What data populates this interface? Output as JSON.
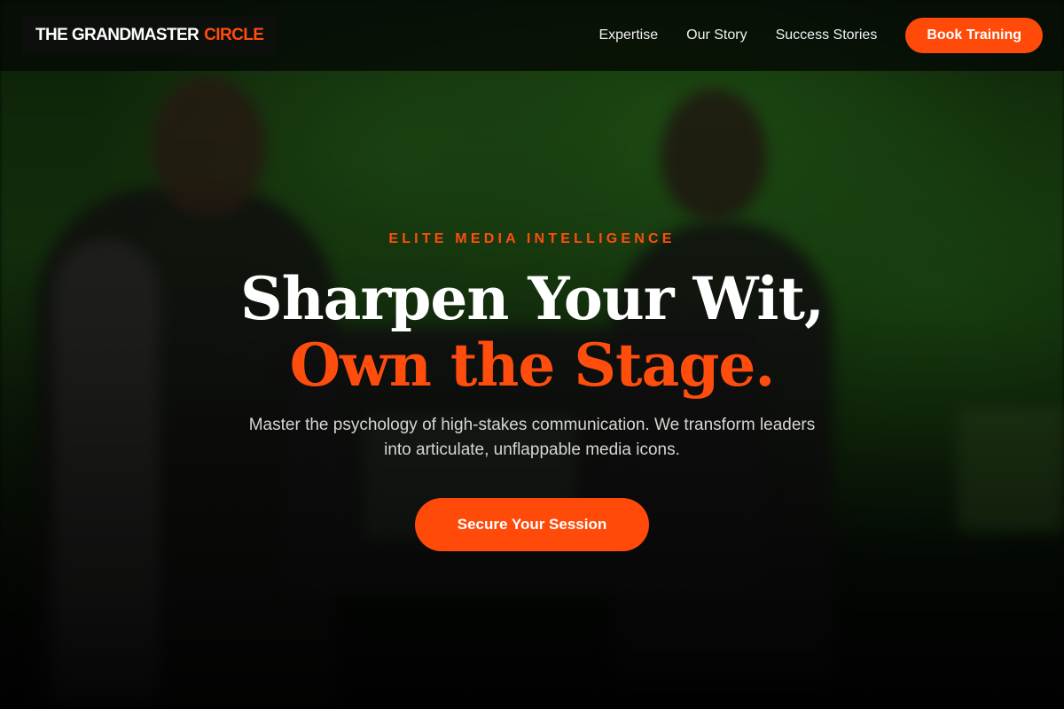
{
  "header": {
    "logo": {
      "primary": "THE GRANDMASTER",
      "accent": "CIRCLE"
    },
    "nav": [
      {
        "label": "Expertise"
      },
      {
        "label": "Our Story"
      },
      {
        "label": "Success Stories"
      }
    ],
    "cta_label": "Book Training"
  },
  "hero": {
    "eyebrow": "ELITE MEDIA INTELLIGENCE",
    "title_line1": "Sharpen Your Wit,",
    "title_line2": "Own the Stage.",
    "subtitle": "Master the psychology of high-stakes communication. We transform leaders into articulate, unflappable media icons.",
    "cta_label": "Secure Your Session"
  },
  "colors": {
    "accent": "#ff4a0a",
    "header_bg": "#050a05",
    "text_primary": "#ffffff",
    "text_secondary": "#d6d6d2",
    "hero_green": "#2b6a1c"
  }
}
